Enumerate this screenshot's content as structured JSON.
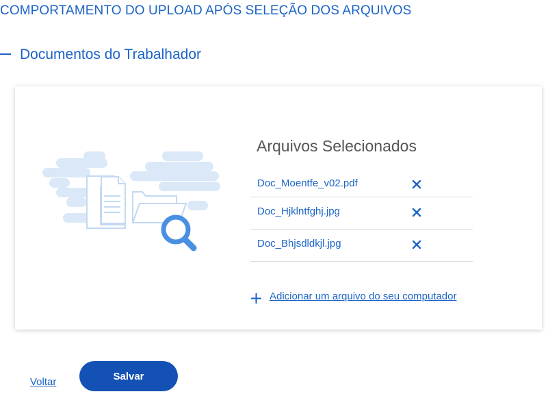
{
  "page": {
    "heading": "COMPORTAMENTO DO UPLOAD APÓS SELEÇÃO DOS ARQUIVOS"
  },
  "section": {
    "title": "Documentos do Trabalhador",
    "toggle_icon": "minus-icon"
  },
  "upload": {
    "illustration_icon": "document-folder-search-illustration",
    "selected_title": "Arquivos Selecionados",
    "files": [
      {
        "name": "Doc_Moentfe_v02.pdf",
        "remove_icon": "close-icon"
      },
      {
        "name": "Doc_Hjklntfghj.jpg",
        "remove_icon": "close-icon"
      },
      {
        "name": "Doc_Bhjsdldkjl.jpg",
        "remove_icon": "close-icon"
      }
    ],
    "add_file_label": "Adicionar um arquivo do seu computador",
    "add_icon": "plus-icon"
  },
  "actions": {
    "back_label": "Voltar",
    "save_label": "Salvar"
  },
  "colors": {
    "primary": "#1351b4",
    "link": "#1b63c6",
    "illustration_light": "#dbe8f8",
    "illustration_dark": "#4a90e2"
  }
}
